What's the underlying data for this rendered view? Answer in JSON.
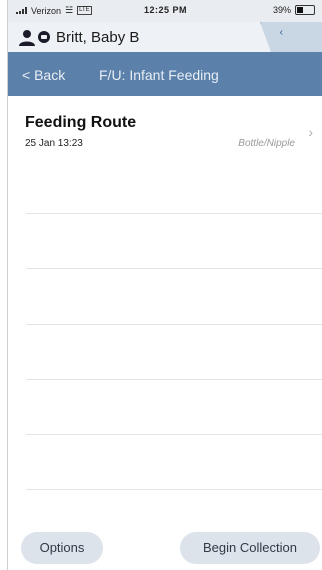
{
  "status_bar": {
    "carrier": "Verizon",
    "network": "LTE",
    "time": "12:25 PM",
    "battery": "39%",
    "battery_level": 0.39
  },
  "patient": {
    "name": "Britt, Baby B"
  },
  "nav": {
    "back_label": "< Back",
    "title": "F/U: Infant Feeding"
  },
  "list": {
    "items": [
      {
        "label": "Feeding Route",
        "timestamp": "25 Jan 13:23",
        "value": "Bottle/Nipple"
      }
    ]
  },
  "footer": {
    "options_label": "Options",
    "begin_label": "Begin Collection"
  }
}
